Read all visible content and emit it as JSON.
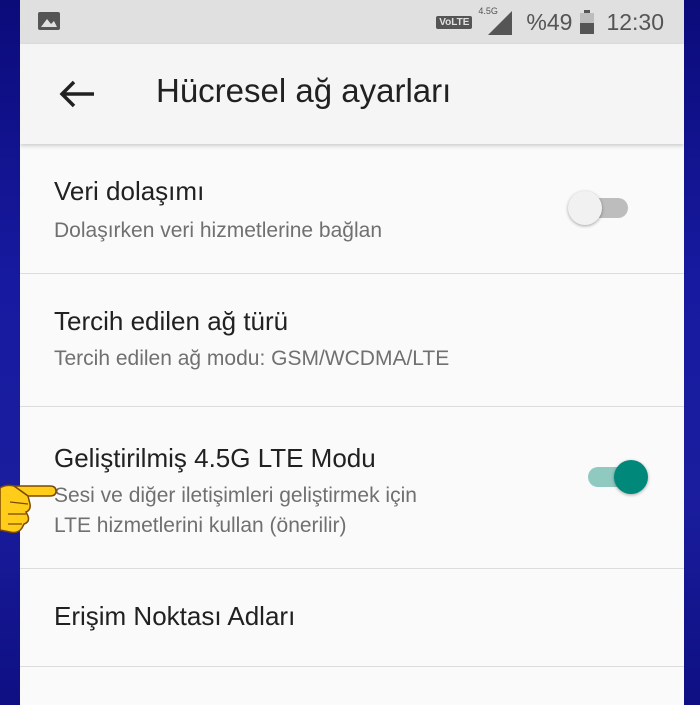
{
  "status_bar": {
    "left_icon": "image-icon",
    "volte": "VoLTE",
    "network_type": "4.5G",
    "signal_icon": "signal-icon",
    "battery_percent": "%49",
    "battery_icon": "battery-icon",
    "time": "12:30"
  },
  "app_bar": {
    "back_icon": "arrow-back-icon",
    "title": "Hücresel ağ ayarları"
  },
  "settings": [
    {
      "title": "Veri dolaşımı",
      "summary": "Dolaşırken veri hizmetlerine bağlan",
      "toggle": "off"
    },
    {
      "title": "Tercih edilen ağ türü",
      "summary": "Tercih edilen ağ modu: GSM/WCDMA/LTE"
    },
    {
      "title": "Geliştirilmiş 4.5G LTE Modu",
      "summary_line1": "Sesi ve diğer iletişimleri geliştirmek için",
      "summary_line2": "LTE hizmetlerini kullan (önerilir)",
      "toggle": "on"
    },
    {
      "title": "Erişim Noktası Adları"
    }
  ],
  "annotation": {
    "icon": "pointing-hand-icon"
  },
  "colors": {
    "background": "#1a1d9e",
    "accent": "#00897b",
    "status_bar": "#e0e0e0"
  }
}
